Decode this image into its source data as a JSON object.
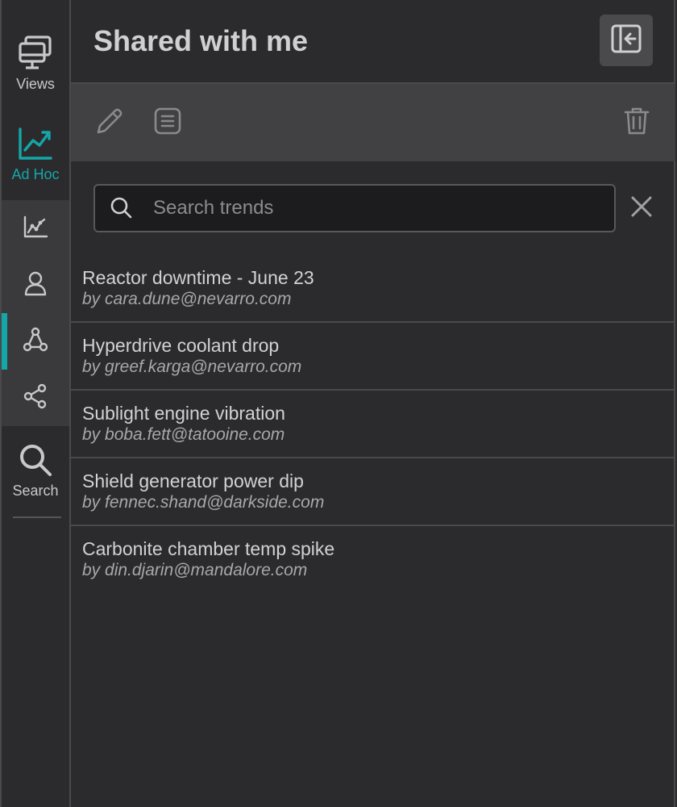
{
  "rail": {
    "views_label": "Views",
    "adhoc_label": "Ad Hoc",
    "search_label": "Search",
    "sub_items": [
      {
        "icon": "line-chart-icon"
      },
      {
        "icon": "user-icon"
      },
      {
        "icon": "network-nodes-icon"
      },
      {
        "icon": "share-icon"
      }
    ],
    "accent_color": "#14a7a8"
  },
  "header": {
    "title": "Shared with me",
    "collapse_icon": "collapse-panel-icon"
  },
  "toolbar": {
    "edit_icon": "pencil-icon",
    "details_icon": "document-list-icon",
    "delete_icon": "trash-icon"
  },
  "search": {
    "placeholder": "Search trends",
    "value": ""
  },
  "trends": [
    {
      "title": "Reactor downtime - June 23",
      "owner": "by cara.dune@nevarro.com"
    },
    {
      "title": "Hyperdrive coolant drop",
      "owner": "by greef.karga@nevarro.com"
    },
    {
      "title": "Sublight engine vibration",
      "owner": "by boba.fett@tatooine.com"
    },
    {
      "title": "Shield generator power dip",
      "owner": "by fennec.shand@darkside.com"
    },
    {
      "title": "Carbonite chamber temp spike",
      "owner": "by din.djarin@mandalore.com"
    }
  ]
}
